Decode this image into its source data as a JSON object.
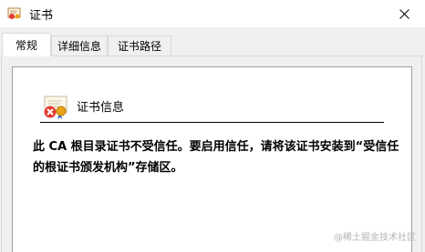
{
  "window": {
    "title": "证书"
  },
  "tabs": [
    {
      "label": "常规",
      "active": true
    },
    {
      "label": "详细信息",
      "active": false
    },
    {
      "label": "证书路径",
      "active": false
    }
  ],
  "info": {
    "title": "证书信息",
    "message": "此 CA 根目录证书不受信任。要启用信任，请将该证书安装到“受信任的根证书颁发机构”存储区。"
  },
  "watermark": "@稀土掘金技术社区",
  "icons": {
    "window": "certificate-icon",
    "close": "close-icon",
    "cert_status": "untrusted-certificate-icon"
  },
  "colors": {
    "error_red": "#e23b2e",
    "seal_gold": "#e8a317"
  }
}
